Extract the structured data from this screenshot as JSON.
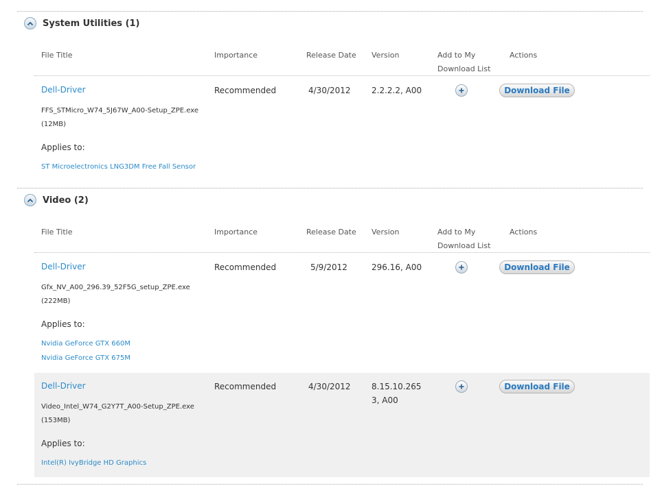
{
  "columns": {
    "file_title": "File Title",
    "importance": "Importance",
    "release_date": "Release Date",
    "version": "Version",
    "add_line1": "Add to My",
    "add_line2": "Download List",
    "actions": "Actions"
  },
  "sections": [
    {
      "title": "System Utilities (1)",
      "items": [
        {
          "title": "Dell-Driver",
          "file": "FFS_STMicro_W74_5J67W_A00-Setup_ZPE.exe",
          "size": "(12MB)",
          "applies_label": "Applies to:",
          "applies": [
            "ST Microelectronics LNG3DM Free Fall Sensor"
          ],
          "importance": "Recommended",
          "release_date": "4/30/2012",
          "version_line1": "2.2.2.2, A00",
          "version_line2": "",
          "download_label": "Download File"
        }
      ]
    },
    {
      "title": "Video (2)",
      "items": [
        {
          "title": "Dell-Driver",
          "file": "Gfx_NV_A00_296.39_52F5G_setup_ZPE.exe",
          "size": "(222MB)",
          "applies_label": "Applies to:",
          "applies": [
            "Nvidia GeForce GTX 660M",
            "Nvidia GeForce GTX 675M"
          ],
          "importance": "Recommended",
          "release_date": "5/9/2012",
          "version_line1": "296.16, A00",
          "version_line2": "",
          "download_label": "Download File"
        },
        {
          "title": "Dell-Driver",
          "file": "Video_Intel_W74_G2Y7T_A00-Setup_ZPE.exe",
          "size": "(153MB)",
          "applies_label": "Applies to:",
          "applies": [
            "Intel(R) IvyBridge HD Graphics"
          ],
          "importance": "Recommended",
          "release_date": "4/30/2012",
          "version_line1": "8.15.10.265",
          "version_line2": "3, A00",
          "download_label": "Download File"
        }
      ]
    }
  ]
}
